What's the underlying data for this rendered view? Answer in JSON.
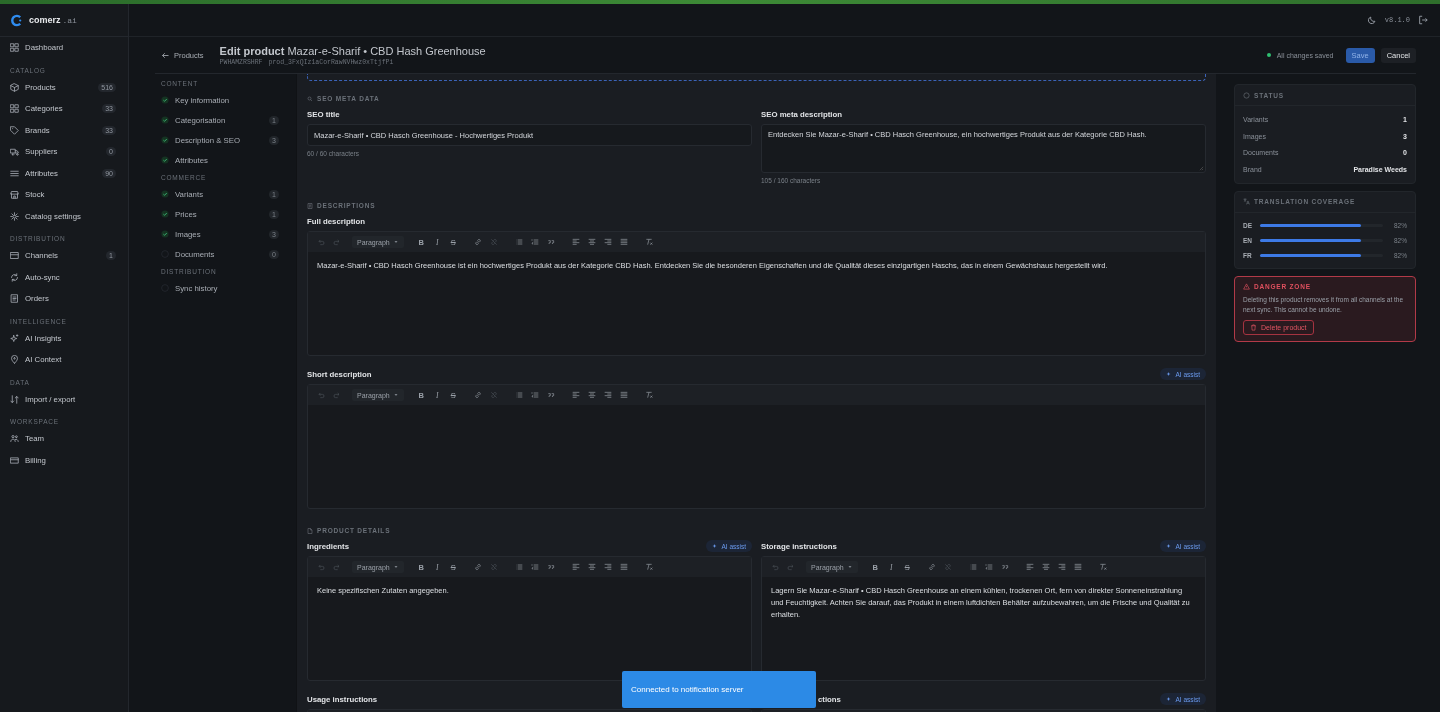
{
  "top_bar": {
    "version": "v8.1.0"
  },
  "sidebar": {
    "brand": {
      "name": "comerz",
      "suffix": ".ai"
    },
    "groups": [
      {
        "items": [
          {
            "label": "Dashboard"
          }
        ]
      },
      {
        "title": "CATALOG",
        "items": [
          {
            "label": "Products",
            "count": "516"
          },
          {
            "label": "Categories",
            "count": "33"
          },
          {
            "label": "Brands",
            "count": "33"
          },
          {
            "label": "Suppliers",
            "count": "0"
          },
          {
            "label": "Attributes",
            "count": "90"
          },
          {
            "label": "Stock"
          },
          {
            "label": "Catalog settings"
          }
        ]
      },
      {
        "title": "DISTRIBUTION",
        "items": [
          {
            "label": "Channels",
            "count": "1"
          },
          {
            "label": "Auto-sync"
          },
          {
            "label": "Orders"
          }
        ]
      },
      {
        "title": "INTELLIGENCE",
        "items": [
          {
            "label": "AI Insights"
          },
          {
            "label": "AI Context"
          }
        ]
      },
      {
        "title": "DATA",
        "items": [
          {
            "label": "Import / export"
          }
        ]
      },
      {
        "title": "WORKSPACE",
        "items": [
          {
            "label": "Team"
          },
          {
            "label": "Billing"
          }
        ]
      }
    ]
  },
  "header": {
    "back": "Products",
    "title": "**Edit product** Mazar-e-Sharif • CBD Hash Greenhouse",
    "sku": "PWHAMZRSHRF",
    "id": "prod_3FxQIz1aCorRawNVHwz0xTtjfPi",
    "save_status": "All changes saved",
    "buttons": [
      {
        "label": "Save",
        "kind": "primary"
      },
      {
        "label": "Cancel",
        "kind": "secondary"
      }
    ]
  },
  "section_nav": [
    {
      "title": "CONTENT",
      "items": [
        {
          "label": "Key information",
          "done": true
        },
        {
          "label": "Categorisation",
          "done": true,
          "count": "1"
        },
        {
          "label": "Description & SEO",
          "done": true,
          "count": "3"
        },
        {
          "label": "Attributes",
          "done": true
        }
      ]
    },
    {
      "title": "COMMERCE",
      "items": [
        {
          "label": "Variants",
          "done": true,
          "count": "1"
        },
        {
          "label": "Prices",
          "done": true,
          "count": "1"
        },
        {
          "label": "Images",
          "done": true,
          "count": "3"
        },
        {
          "label": "Documents",
          "done": false,
          "count": "0"
        }
      ]
    },
    {
      "title": "DISTRIBUTION",
      "items": [
        {
          "label": "Sync history",
          "done": false
        }
      ]
    }
  ],
  "sections": [
    {
      "title": "SEO META DATA",
      "kind": "seo",
      "fields": [
        {
          "kind": "input",
          "label": "SEO title",
          "value": "Mazar-e-Sharif • CBD Hasch Greenhouse - Hochwertiges Produkt",
          "counter": "60 / 60 characters"
        },
        {
          "kind": "textarea",
          "label": "SEO meta description",
          "value": "Entdecken Sie Mazar-e-Sharif • CBD Hasch Greenhouse, ein hochwertiges Produkt aus der Kategorie CBD Hash.",
          "counter": "105 / 160 characters"
        }
      ]
    },
    {
      "title": "DESCRIPTIONS",
      "kind": "doc",
      "fields": [
        {
          "kind": "editor",
          "label": "Full description",
          "toolbar": {
            "block_format": "Paragraph",
            "marks": [
              "B",
              "I",
              "S"
            ]
          },
          "value": "Mazar-e-Sharif • CBD Hasch Greenhouse ist ein hochwertiges Produkt aus der Kategorie CBD Hash. Entdecken Sie die besonderen Eigenschaften und die Qualität dieses einzigartigen Haschs, das in einem Gewächshaus hergestellt wird."
        },
        {
          "kind": "editor",
          "label": "Short description",
          "ai": "AI assist",
          "toolbar": {
            "block_format": "Paragraph",
            "marks": [
              "B",
              "I",
              "S"
            ]
          }
        }
      ]
    },
    {
      "title": "PRODUCT DETAILS",
      "kind": "file",
      "fields": [
        {
          "kind": "editor",
          "label": "Ingredients",
          "ai": "AI assist",
          "toolbar": {
            "block_format": "Paragraph",
            "marks": [
              "B",
              "I",
              "S"
            ]
          },
          "value": "Keine spezifischen Zutaten angegeben."
        },
        {
          "kind": "editor",
          "label": "Storage instructions",
          "ai": "AI assist",
          "toolbar": {
            "block_format": "Paragraph",
            "marks": [
              "B",
              "I",
              "S"
            ]
          },
          "value": "Lagern Sie Mazar-e-Sharif • CBD Hasch Greenhouse an einem kühlen, trockenen Ort, fern von direkter Sonneneinstrahlung und Feuchtigkeit. Achten Sie darauf, das Produkt in einem luftdichten Behälter aufzubewahren, um die Frische und Qualität zu erhalten."
        },
        {
          "kind": "editor",
          "label": "Usage instructions"
        },
        {
          "kind": "editor",
          "label": "ctions",
          "covered": true,
          "ai": "AI assist"
        }
      ]
    }
  ],
  "status": {
    "title": "STATUS",
    "rows": [
      {
        "label": "Variants",
        "value": "1"
      },
      {
        "label": "Images",
        "value": "3"
      },
      {
        "label": "Documents",
        "value": "0"
      },
      {
        "label": "Brand",
        "value": "Paradise Weeds"
      }
    ]
  },
  "translation": {
    "title": "TRANSLATION COVERAGE",
    "rows": [
      {
        "lang": "DE",
        "level": 0.82,
        "reading": "82%"
      },
      {
        "lang": "EN",
        "level": 0.82,
        "reading": "82%"
      },
      {
        "lang": "FR",
        "level": 0.82,
        "reading": "82%"
      }
    ]
  },
  "danger": {
    "title": "DANGER ZONE",
    "text": "Deleting this product removes it from all channels at the next sync. This cannot be undone.",
    "button": "Delete product"
  },
  "toast": {
    "text": "Connected to notification server"
  }
}
